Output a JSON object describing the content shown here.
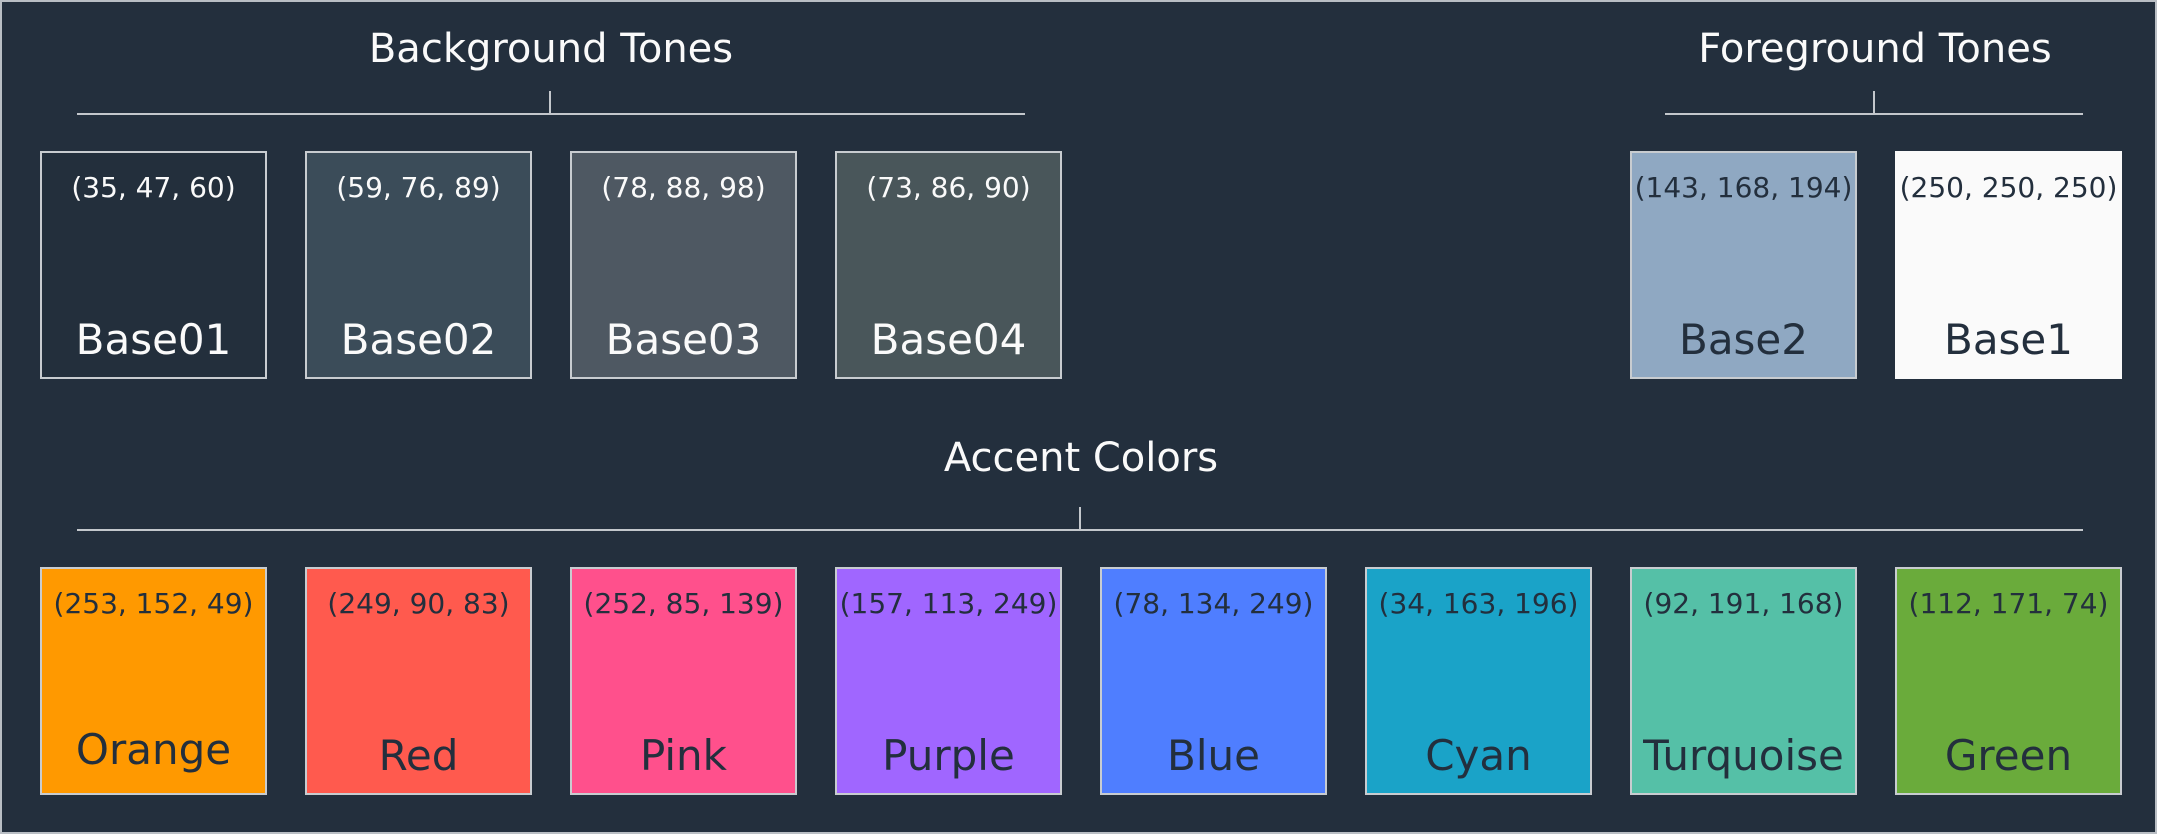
{
  "sections": {
    "background": {
      "title": "Background Tones",
      "swatches": [
        {
          "name": "Base01",
          "rgb": "(35, 47, 60)",
          "fill": "#232f3c",
          "text_color": "#fafafa"
        },
        {
          "name": "Base02",
          "rgb": "(59, 76, 89)",
          "fill": "#3b4c59",
          "text_color": "#fafafa"
        },
        {
          "name": "Base03",
          "rgb": "(78, 88, 98)",
          "fill": "#4e5862",
          "text_color": "#fafafa"
        },
        {
          "name": "Base04",
          "rgb": "(73, 86, 90)",
          "fill": "#49565a",
          "text_color": "#fafafa"
        }
      ]
    },
    "foreground": {
      "title": "Foreground Tones",
      "swatches": [
        {
          "name": "Base2",
          "rgb": "(143, 168, 194)",
          "fill": "#8fa8c2",
          "text_color": "#232f3d"
        },
        {
          "name": "Base1",
          "rgb": "(250, 250, 250)",
          "fill": "#fafafa",
          "text_color": "#232f3d"
        }
      ]
    },
    "accent": {
      "title": "Accent Colors",
      "swatches": [
        {
          "name": "Orange",
          "rgb": "(253, 152, 49)",
          "fill": "#ff9900",
          "text_color": "#232f3d"
        },
        {
          "name": "Red",
          "rgb": "(249, 90, 83)",
          "fill": "#ff5a4e",
          "text_color": "#232f3d"
        },
        {
          "name": "Pink",
          "rgb": "(252, 85, 139)",
          "fill": "#ff508c",
          "text_color": "#232f3d"
        },
        {
          "name": "Purple",
          "rgb": "(157, 113, 249)",
          "fill": "#a066ff",
          "text_color": "#232f3d"
        },
        {
          "name": "Blue",
          "rgb": "(78, 134, 249)",
          "fill": "#4f7eff",
          "text_color": "#232f3d"
        },
        {
          "name": "Cyan",
          "rgb": "(34, 163, 196)",
          "fill": "#1aa3c8",
          "text_color": "#232f3d"
        },
        {
          "name": "Turquoise",
          "rgb": "(92, 191, 168)",
          "fill": "#55c0a7",
          "text_color": "#232f3d"
        },
        {
          "name": "Green",
          "rgb": "(112, 171, 74)",
          "fill": "#6aab3b",
          "text_color": "#232f3d"
        }
      ]
    }
  }
}
